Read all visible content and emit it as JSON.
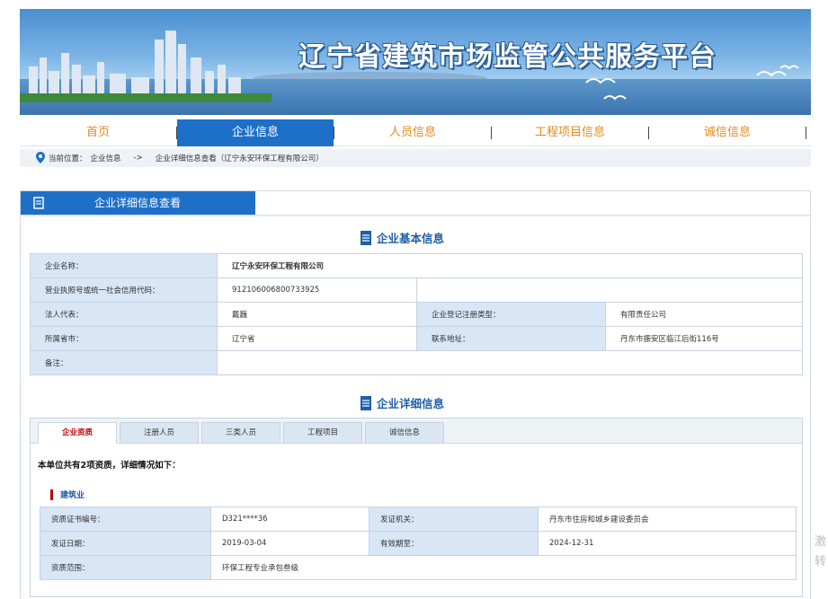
{
  "banner": {
    "title": "辽宁省建筑市场监管公共服务平台"
  },
  "nav": {
    "items": [
      {
        "label": "首页"
      },
      {
        "label": "企业信息"
      },
      {
        "label": "人员信息"
      },
      {
        "label": "工程项目信息"
      },
      {
        "label": "诚信信息"
      }
    ],
    "active_index": 1
  },
  "breadcrumb": {
    "prefix": "当前位置：",
    "level1": "企业信息",
    "arrow": "->",
    "level2": "企业详细信息查看（辽宁永安环保工程有限公司）"
  },
  "panel": {
    "title": "企业详细信息查看"
  },
  "basic": {
    "section_title": "企业基本信息",
    "company_name_label": "企业名称：",
    "company_name": "辽宁永安环保工程有限公司",
    "license_label": "营业执照号或统一社会信用代码：",
    "license": "912106006800733925",
    "legal_rep_label": "法人代表：",
    "legal_rep": "戴巍",
    "reg_type_label": "企业登记注册类型：",
    "reg_type": "有限责任公司",
    "province_label": "所属省市：",
    "province": "辽宁省",
    "address_label": "联系地址：",
    "address": "丹东市振安区临江后街116号",
    "remark_label": "备注：",
    "remark": ""
  },
  "detail": {
    "section_title": "企业详细信息",
    "tabs": [
      "企业资质",
      "注册人员",
      "三类人员",
      "工程项目",
      "诚信信息"
    ],
    "active_tab": 0,
    "summary": "本单位共有2项资质，详细情况如下：",
    "category": "建筑业",
    "qual": {
      "cert_no_label": "资质证书编号：",
      "cert_no": "D321****36",
      "issuer_label": "发证机关：",
      "issuer": "丹东市住房和城乡建设委员会",
      "issue_date_label": "发证日期：",
      "issue_date": "2019-03-04",
      "valid_until_label": "有效期至：",
      "valid_until": "2024-12-31",
      "scope_label": "资质范围：",
      "scope": "环保工程专业承包叁级"
    }
  },
  "side": {
    "line1": "激",
    "line2": "转"
  }
}
